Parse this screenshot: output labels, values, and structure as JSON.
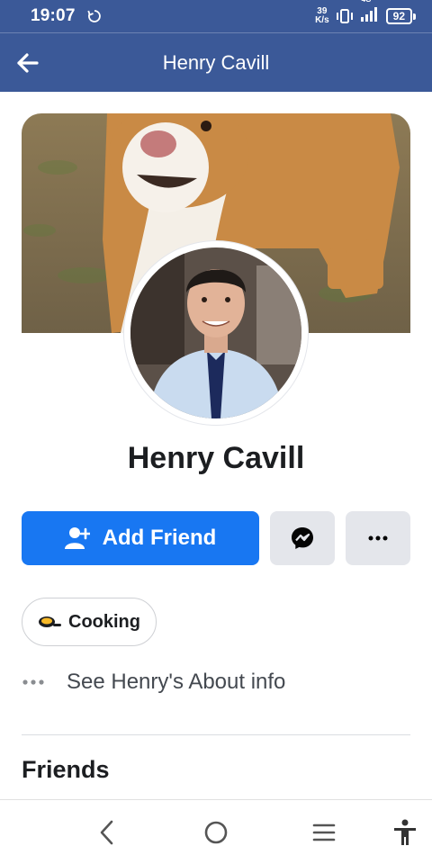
{
  "status_bar": {
    "time": "19:07",
    "net_speed_value": "39",
    "net_speed_unit": "K/s",
    "network_type": "4G",
    "battery": "92"
  },
  "app_bar": {
    "title": "Henry Cavill"
  },
  "profile": {
    "name": "Henry Cavill"
  },
  "actions": {
    "add_friend_label": "Add Friend"
  },
  "chips": {
    "interest_label": "Cooking"
  },
  "about": {
    "text": "See Henry's About info"
  },
  "sections": {
    "friends_title": "Friends"
  },
  "colors": {
    "brand_bar": "#3b5998",
    "primary_button": "#1877f2",
    "secondary_button": "#e4e6eb"
  }
}
